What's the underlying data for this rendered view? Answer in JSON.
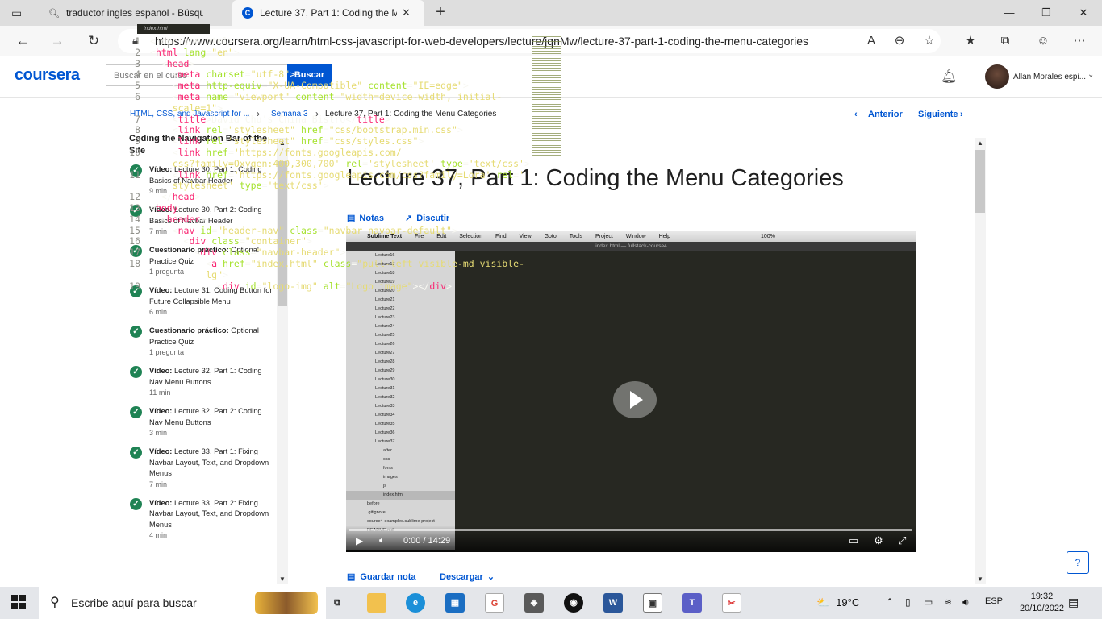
{
  "browser": {
    "tabs": [
      {
        "title": "traductor ingles espanol - Búsqu",
        "active": false
      },
      {
        "title": "Lecture 37, Part 1: Coding the M",
        "active": true
      }
    ],
    "url": "https://www.coursera.org/learn/html-css-javascript-for-web-developers/lecture/jqnMw/lecture-37-part-1-coding-the-menu-categories"
  },
  "header": {
    "logo": "coursera",
    "search_placeholder": "Buscar en el curso",
    "search_button": "Buscar",
    "user_name": "Allan Morales espi..."
  },
  "breadcrumb": {
    "course": "HTML, CSS, and Javascript for ...",
    "week": "Semana 3",
    "current": "Lecture 37, Part 1: Coding the Menu Categories"
  },
  "pager": {
    "prev": "Anterior",
    "next": "Siguiente"
  },
  "sidebar": {
    "section_title": "Coding the Navigation Bar of the Site",
    "items": [
      {
        "type": "Vídeo:",
        "title": "Lecture 30, Part 1: Coding Basics of Navbar Header",
        "meta": "9 min"
      },
      {
        "type": "Vídeo:",
        "title": "Lecture 30, Part 2: Coding Basics of Navbar Header",
        "meta": "7 min"
      },
      {
        "type": "Cuestionario práctico:",
        "title": "Optional Practice Quiz",
        "meta": "1 pregunta"
      },
      {
        "type": "Vídeo:",
        "title": "Lecture 31: Coding Button for Future Collapsible Menu",
        "meta": "6 min"
      },
      {
        "type": "Cuestionario práctico:",
        "title": "Optional Practice Quiz",
        "meta": "1 pregunta"
      },
      {
        "type": "Vídeo:",
        "title": "Lecture 32, Part 1: Coding Nav Menu Buttons",
        "meta": "11 min"
      },
      {
        "type": "Vídeo:",
        "title": "Lecture 32, Part 2: Coding Nav Menu Buttons",
        "meta": "3 min"
      },
      {
        "type": "Vídeo:",
        "title": "Lecture 33, Part 1: Fixing Navbar Layout, Text, and Dropdown Menus",
        "meta": "7 min"
      },
      {
        "type": "Vídeo:",
        "title": "Lecture 33, Part 2: Fixing Navbar Layout, Text, and Dropdown Menus",
        "meta": "4 min"
      }
    ]
  },
  "main": {
    "title": "Lecture 37, Part 1: Coding the Menu Categories",
    "notes": "Notas",
    "discuss": "Discutir",
    "save_note": "Guardar nota",
    "download": "Descargar"
  },
  "video": {
    "time": "0:00 / 14:29",
    "app_name": "Sublime Text",
    "mac_menu": [
      "File",
      "Edit",
      "Selection",
      "Find",
      "View",
      "Goto",
      "Tools",
      "Project",
      "Window",
      "Help"
    ],
    "window_title": "index.html — fullstack-course4",
    "battery": "100%",
    "editor_tab": "index.html",
    "tree": [
      "Lecture16",
      "Lecture17",
      "Lecture18",
      "Lecture19",
      "Lecture20",
      "Lecture21",
      "Lecture22",
      "Lecture23",
      "Lecture24",
      "Lecture25",
      "Lecture26",
      "Lecture27",
      "Lecture28",
      "Lecture29",
      "Lecture30",
      "Lecture31",
      "Lecture32",
      "Lecture33",
      "Lecture34",
      "Lecture35",
      "Lecture36",
      "Lecture37",
      "after",
      "css",
      "fonts",
      "images",
      "js",
      "index.html",
      "before",
      ".gitignore",
      "course4-examples.sublime-project",
      "README.md"
    ]
  },
  "taskbar": {
    "search": "Escribe aquí para buscar",
    "temperature": "19°C",
    "lang": "ESP",
    "time": "19:32",
    "date": "20/10/2022"
  }
}
